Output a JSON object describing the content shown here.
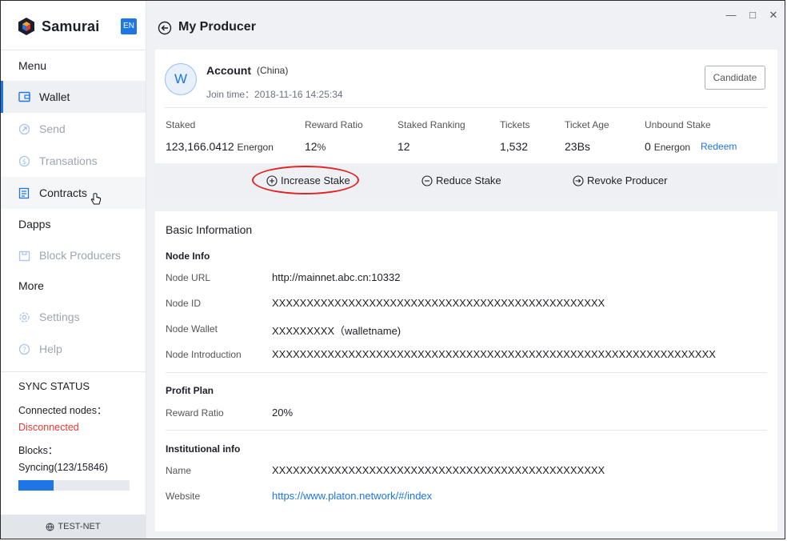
{
  "app": {
    "name": "Samurai",
    "lang": "EN"
  },
  "sidebar": {
    "menu_label": "Menu",
    "items_menu": [
      {
        "label": "Wallet",
        "icon": "wallet-icon"
      },
      {
        "label": "Send",
        "icon": "send-icon"
      },
      {
        "label": "Transations",
        "icon": "dollar-icon"
      },
      {
        "label": "Contracts",
        "icon": "contract-icon"
      }
    ],
    "dapps_label": "Dapps",
    "items_dapps": [
      {
        "label": "Block Producers",
        "icon": "block-producers-icon"
      }
    ],
    "more_label": "More",
    "items_more": [
      {
        "label": "Settings",
        "icon": "gear-icon"
      },
      {
        "label": "Help",
        "icon": "help-icon"
      }
    ],
    "sync": {
      "title": "SYNC STATUS",
      "connected_label": "Connected nodes：",
      "connected_status": "Disconnected",
      "blocks_label": "Blocks：",
      "blocks_value": "Syncing(123/15846)",
      "progress": 0.32
    },
    "network": "TEST-NET"
  },
  "header": {
    "title": "My Producer"
  },
  "account": {
    "avatar_letter": "W",
    "name": "Account",
    "region": "(China)",
    "join": "Join time：2018-11-16 14:25:34",
    "candidate_button": "Candidate"
  },
  "stats": {
    "staked_label": "Staked",
    "staked_value": "123,166.0412",
    "staked_unit": "Energon",
    "reward_label": "Reward Ratio",
    "reward_value": "12",
    "reward_unit": "%",
    "ranking_label": "Staked Ranking",
    "ranking_value": "12",
    "tickets_label": "Tickets",
    "tickets_value": "1,532",
    "age_label": "Ticket Age",
    "age_value": "23Bs",
    "unbound_label": "Unbound Stake",
    "unbound_value": "0",
    "unbound_unit": "Energon",
    "redeem_link": "Redeem"
  },
  "actions": {
    "increase": "Increase Stake",
    "reduce": "Reduce Stake",
    "revoke": "Revoke Producer"
  },
  "basic": {
    "title": "Basic Information",
    "node_info_label": "Node Info",
    "node_url_label": "Node URL",
    "node_url": "http://mainnet.abc.cn:10332",
    "node_id_label": "Node ID",
    "node_id": "XXXXXXXXXXXXXXXXXXXXXXXXXXXXXXXXXXXXXXXXXXXXXXXX",
    "node_wallet_label": "Node Wallet",
    "node_wallet": "XXXXXXXXX（walletname)",
    "node_intro_label": "Node Introduction",
    "node_intro": "XXXXXXXXXXXXXXXXXXXXXXXXXXXXXXXXXXXXXXXXXXXXXXXXXXXXXXXXXXXXXXXX",
    "profit_label": "Profit Plan",
    "reward_ratio_label": "Reward Ratio",
    "reward_ratio": "20%",
    "inst_label": "Institutional info",
    "name_label": "Name",
    "name": "XXXXXXXXXXXXXXXXXXXXXXXXXXXXXXXXXXXXXXXXXXXXXXXX",
    "website_label": "Website",
    "website": "https://www.platon.network/#/index"
  }
}
